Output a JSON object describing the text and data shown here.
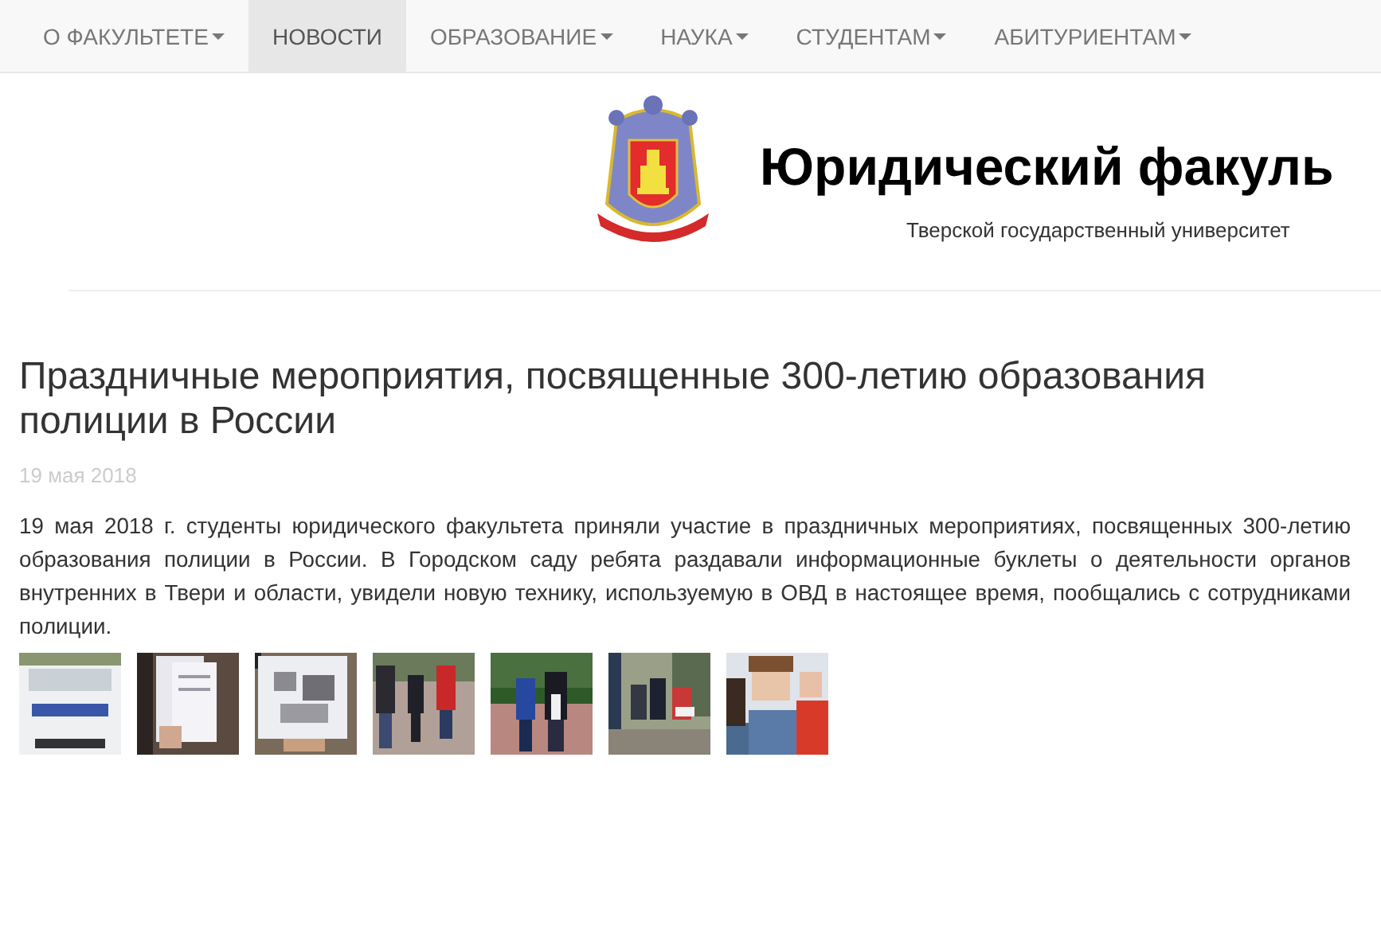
{
  "nav": [
    {
      "label": "О ФАКУЛЬТЕТЕ",
      "dropdown": true,
      "selected": false
    },
    {
      "label": "НОВОСТИ",
      "dropdown": false,
      "selected": true
    },
    {
      "label": "ОБРАЗОВАНИЕ",
      "dropdown": true,
      "selected": false
    },
    {
      "label": "НАУКА",
      "dropdown": true,
      "selected": false
    },
    {
      "label": "СТУДЕНТАМ",
      "dropdown": true,
      "selected": false
    },
    {
      "label": "АБИТУРИЕНТАМ",
      "dropdown": true,
      "selected": false
    }
  ],
  "header": {
    "title": "Юридический факуль",
    "subtitle": "Тверской государственный университет"
  },
  "article": {
    "title": "Праздничные мероприятия, посвященные 300-летию образования полиции в России",
    "date": "19 мая 2018",
    "body": "19 мая 2018 г. студенты юридического факультета приняли участие в праздничных мероприятиях, посвященных 300-летию образования полиции в России. В Городском саду ребята раздавали информационные буклеты о деятельности органов внутренних в Твери и области, увидели новую технику, используемую в ОВД в настоящее время, пообщались с сотрудниками полиции."
  }
}
